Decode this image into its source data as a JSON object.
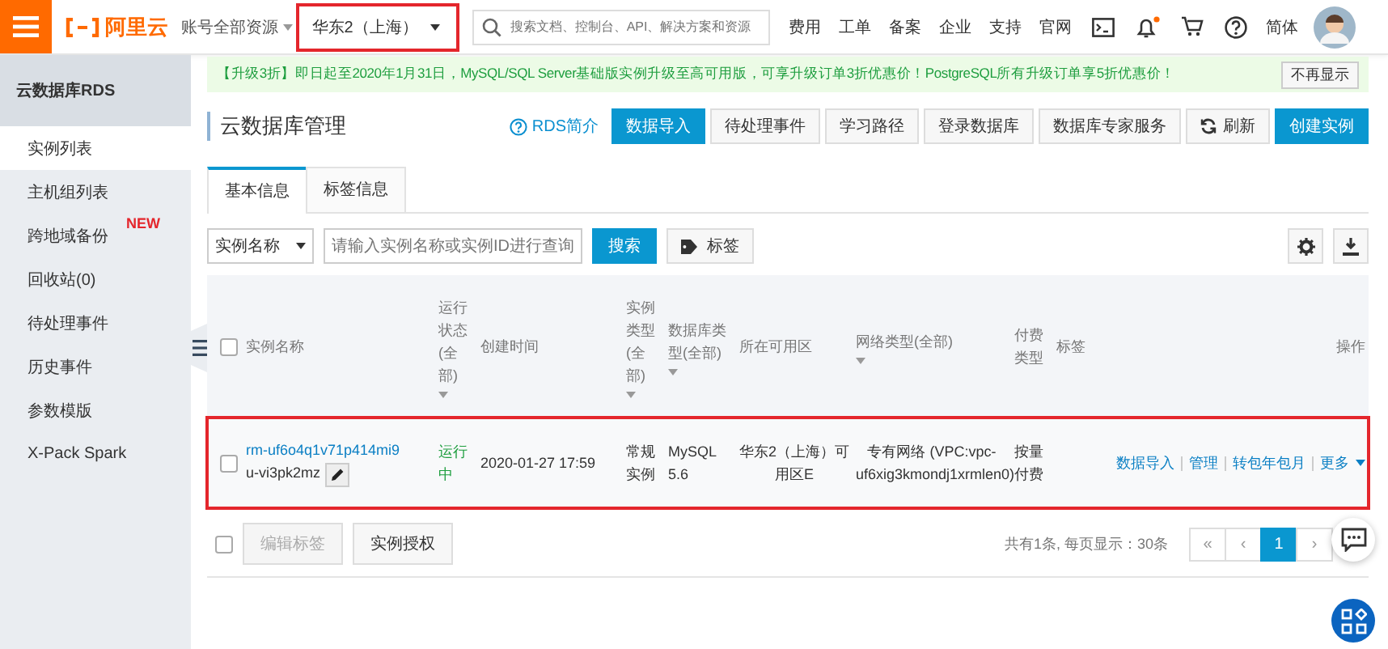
{
  "topbar": {
    "logo": "阿里云",
    "account": "账号全部资源",
    "region": {
      "label": "华东2（上海）",
      "highlighted": true
    },
    "search": {
      "placeholder": "搜索文档、控制台、API、解决方案和资源"
    },
    "links": [
      "费用",
      "工单",
      "备案",
      "企业",
      "支持",
      "官网"
    ],
    "bell_unread": true,
    "language": "简体"
  },
  "sidebar": {
    "title": "云数据库RDS",
    "items": [
      {
        "label": "实例列表",
        "selected": true
      },
      {
        "label": "主机组列表",
        "selected": false
      },
      {
        "label": "跨地域备份",
        "selected": false,
        "badge": "NEW"
      },
      {
        "label": "回收站(0)",
        "selected": false
      },
      {
        "label": "待处理事件",
        "selected": false
      },
      {
        "label": "历史事件",
        "selected": false
      },
      {
        "label": "参数模版",
        "selected": false
      },
      {
        "label": "X-Pack Spark",
        "selected": false
      }
    ]
  },
  "banner": {
    "text": "【升级3折】即日起至2020年1月31日，MySQL/SQL Server基础版实例升级至高可用版，可享升级订单3折优惠价！PostgreSQL所有升级订单享5折优惠价！",
    "dismiss": "不再显示"
  },
  "page": {
    "title": "云数据库管理",
    "help_link": "RDS简介",
    "buttons": [
      {
        "label": "数据导入",
        "kind": "primary"
      },
      {
        "label": "待处理事件",
        "kind": "default"
      },
      {
        "label": "学习路径",
        "kind": "default"
      },
      {
        "label": "登录数据库",
        "kind": "default"
      },
      {
        "label": "数据库专家服务",
        "kind": "default"
      },
      {
        "label": "刷新",
        "kind": "refresh"
      },
      {
        "label": "创建实例",
        "kind": "primary"
      }
    ]
  },
  "tabs": [
    {
      "label": "基本信息",
      "selected": true
    },
    {
      "label": "标签信息",
      "selected": false
    }
  ],
  "filter": {
    "field": "实例名称",
    "placeholder": "请输入实例名称或实例ID进行查询",
    "search": "搜索",
    "tag": "标签"
  },
  "table": {
    "select_all_checked": false,
    "columns": [
      {
        "label": "实例名称",
        "dropdown": false
      },
      {
        "label": "运行状态(全部)",
        "dropdown": true
      },
      {
        "label": "创建时间",
        "dropdown": false
      },
      {
        "label": "实例类型(全部)",
        "dropdown": true
      },
      {
        "label": "数据库类型(全部)",
        "dropdown": true
      },
      {
        "label": "所在可用区",
        "dropdown": false
      },
      {
        "label": "网络类型(全部)",
        "dropdown": true
      },
      {
        "label": "付费类型",
        "dropdown": false
      },
      {
        "label": "标签",
        "dropdown": false
      },
      {
        "label": "操作",
        "dropdown": false
      }
    ],
    "rows": [
      {
        "checked": false,
        "highlighted": true,
        "id": "rm-uf6o4q1v71p414mi9",
        "name": "u-vi3pk2mz",
        "status": "运行中",
        "created": "2020-01-27 17:59",
        "instance_type": "常规实例",
        "db_type": "MySQL 5.6",
        "zone": "华东2（上海）可用区E",
        "network": "专有网络 (VPC:vpc-uf6xig3kmondj1xrmlen0)",
        "pay_type": "按量付费",
        "actions": [
          {
            "label": "数据导入",
            "dropdown": false
          },
          {
            "label": "管理",
            "dropdown": false
          },
          {
            "label": "转包年包月",
            "dropdown": false
          },
          {
            "label": "更多",
            "dropdown": true
          }
        ]
      }
    ]
  },
  "footer": {
    "checked": false,
    "buttons": [
      {
        "label": "编辑标签",
        "disabled": true
      },
      {
        "label": "实例授权",
        "disabled": false
      }
    ],
    "summary": "共有1条, 每页显示：30条",
    "pages": [
      {
        "label": "«",
        "selected": false
      },
      {
        "label": "‹",
        "selected": false
      },
      {
        "label": "1",
        "selected": true
      },
      {
        "label": "›",
        "selected": false
      }
    ]
  }
}
